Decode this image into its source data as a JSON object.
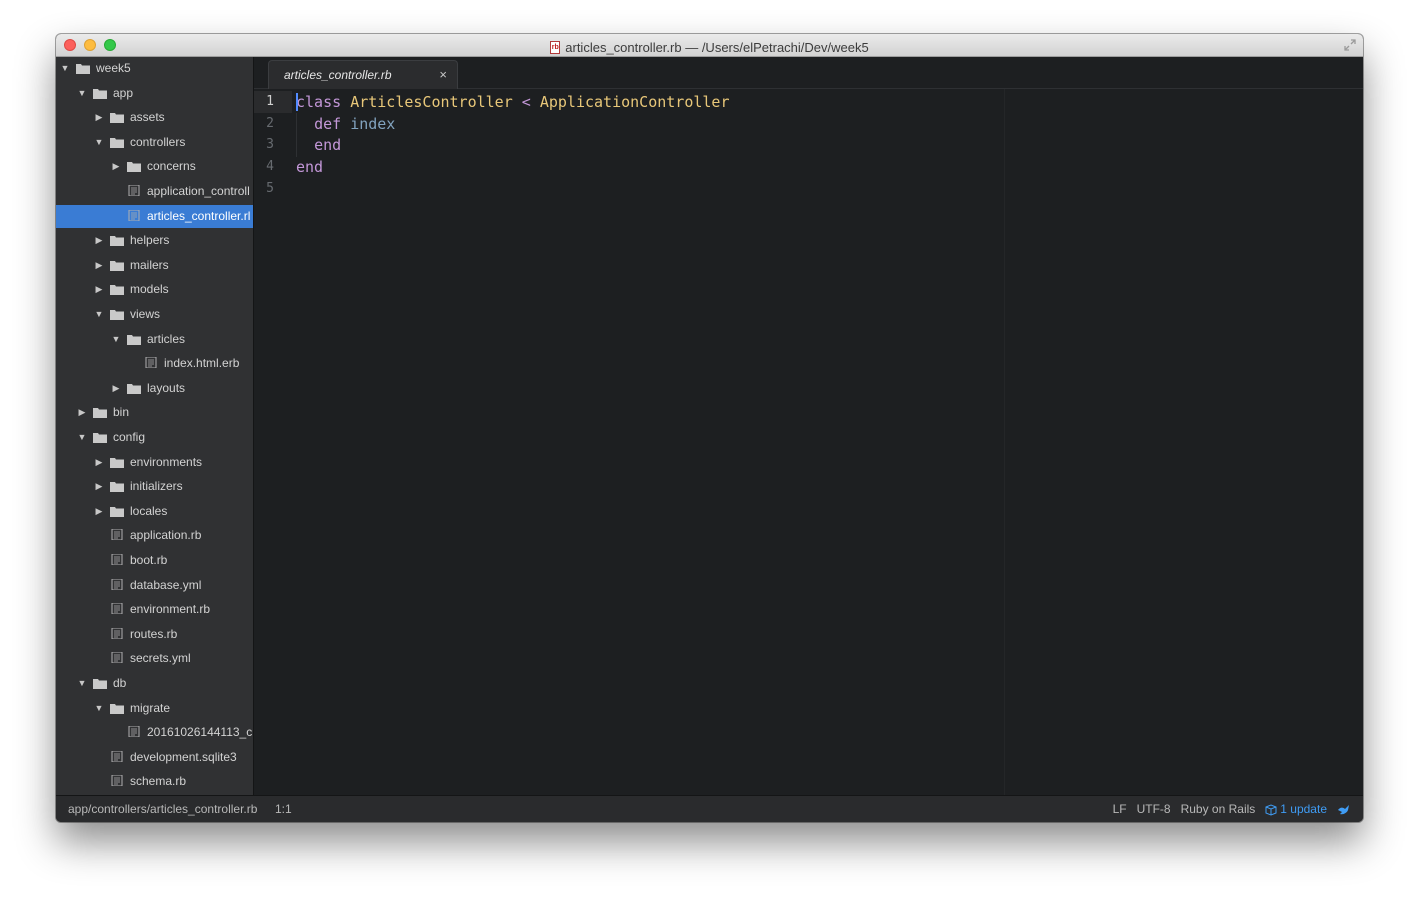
{
  "window": {
    "title": "articles_controller.rb — /Users/elPetrachi/Dev/week5",
    "file_icon_label": "rb"
  },
  "tree": [
    {
      "label": "week5",
      "type": "folder",
      "state": "expanded",
      "depth": 0
    },
    {
      "label": "app",
      "type": "folder",
      "state": "expanded",
      "depth": 1
    },
    {
      "label": "assets",
      "type": "folder",
      "state": "collapsed",
      "depth": 2
    },
    {
      "label": "controllers",
      "type": "folder",
      "state": "expanded",
      "depth": 2
    },
    {
      "label": "concerns",
      "type": "folder",
      "state": "collapsed",
      "depth": 3
    },
    {
      "label": "application_controll",
      "type": "file",
      "depth": 3
    },
    {
      "label": "articles_controller.rl",
      "type": "file",
      "depth": 3,
      "selected": true
    },
    {
      "label": "helpers",
      "type": "folder",
      "state": "collapsed",
      "depth": 2
    },
    {
      "label": "mailers",
      "type": "folder",
      "state": "collapsed",
      "depth": 2
    },
    {
      "label": "models",
      "type": "folder",
      "state": "collapsed",
      "depth": 2
    },
    {
      "label": "views",
      "type": "folder",
      "state": "expanded",
      "depth": 2
    },
    {
      "label": "articles",
      "type": "folder",
      "state": "expanded",
      "depth": 3
    },
    {
      "label": "index.html.erb",
      "type": "file",
      "depth": 4
    },
    {
      "label": "layouts",
      "type": "folder",
      "state": "collapsed",
      "depth": 3
    },
    {
      "label": "bin",
      "type": "folder",
      "state": "collapsed",
      "depth": 1
    },
    {
      "label": "config",
      "type": "folder",
      "state": "expanded",
      "depth": 1
    },
    {
      "label": "environments",
      "type": "folder",
      "state": "collapsed",
      "depth": 2
    },
    {
      "label": "initializers",
      "type": "folder",
      "state": "collapsed",
      "depth": 2
    },
    {
      "label": "locales",
      "type": "folder",
      "state": "collapsed",
      "depth": 2
    },
    {
      "label": "application.rb",
      "type": "file",
      "depth": 2
    },
    {
      "label": "boot.rb",
      "type": "file",
      "depth": 2
    },
    {
      "label": "database.yml",
      "type": "file",
      "depth": 2
    },
    {
      "label": "environment.rb",
      "type": "file",
      "depth": 2
    },
    {
      "label": "routes.rb",
      "type": "file",
      "depth": 2
    },
    {
      "label": "secrets.yml",
      "type": "file",
      "depth": 2
    },
    {
      "label": "db",
      "type": "folder",
      "state": "expanded",
      "depth": 1
    },
    {
      "label": "migrate",
      "type": "folder",
      "state": "expanded",
      "depth": 2
    },
    {
      "label": "20161026144113_c",
      "type": "file",
      "depth": 3
    },
    {
      "label": "development.sqlite3",
      "type": "file",
      "depth": 2
    },
    {
      "label": "schema.rb",
      "type": "file",
      "depth": 2
    }
  ],
  "tab": {
    "label": "articles_controller.rb",
    "close_glyph": "×"
  },
  "editor": {
    "line_numbers": [
      "1",
      "2",
      "3",
      "4",
      "5"
    ],
    "active_line": 1,
    "lines": [
      [
        {
          "t": "class",
          "c": "kw"
        },
        {
          "t": " ",
          "c": ""
        },
        {
          "t": "ArticlesController",
          "c": "cls"
        },
        {
          "t": " ",
          "c": ""
        },
        {
          "t": "<",
          "c": "op"
        },
        {
          "t": " ",
          "c": ""
        },
        {
          "t": "ApplicationController",
          "c": "cls"
        }
      ],
      [
        {
          "t": "  ",
          "c": ""
        },
        {
          "t": "def",
          "c": "kw"
        },
        {
          "t": " ",
          "c": ""
        },
        {
          "t": "index",
          "c": "fn"
        }
      ],
      [
        {
          "t": "  ",
          "c": ""
        },
        {
          "t": "end",
          "c": "kw"
        }
      ],
      [
        {
          "t": "end",
          "c": "kw"
        }
      ],
      []
    ]
  },
  "status": {
    "path": "app/controllers/articles_controller.rb",
    "cursor": "1:1",
    "line_ending": "LF",
    "encoding": "UTF-8",
    "grammar": "Ruby on Rails",
    "update": "1 update"
  },
  "colors": {
    "accent": "#3a7cd4",
    "update_link": "#3f9cf4"
  },
  "icons": [
    "folder-icon",
    "file-icon",
    "chevron-right-icon",
    "chevron-down-icon",
    "close-icon",
    "fullscreen-icon",
    "package-icon",
    "bird-icon"
  ]
}
